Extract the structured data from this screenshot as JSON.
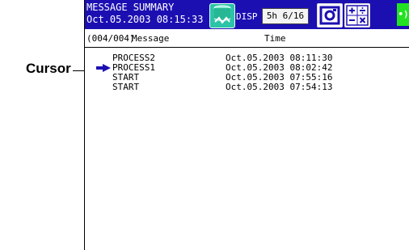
{
  "callout": {
    "label": "Cursor"
  },
  "status_bar": {
    "title": "MESSAGE SUMMARY",
    "datetime": "Oct.05.2003 08:15:33",
    "disp_label": "DISP",
    "disp_value": "5h 6/16",
    "status_color": "#1c0fb2"
  },
  "icons": {
    "recording": "recording-drum-icon",
    "camera": "snapshot-icon",
    "math": "math-calc-icon",
    "network": "network-icon"
  },
  "list": {
    "count": "(004/004)",
    "message_header": "Message",
    "time_header": "Time",
    "rows": [
      {
        "message": "PROCESS2",
        "time": "Oct.05.2003 08:11:30"
      },
      {
        "message": "PROCESS1",
        "time": "Oct.05.2003 08:02:42"
      },
      {
        "message": "START",
        "time": "Oct.05.2003 07:55:16"
      },
      {
        "message": "START",
        "time": "Oct.05.2003 07:54:13"
      }
    ],
    "cursor_row": 1
  }
}
